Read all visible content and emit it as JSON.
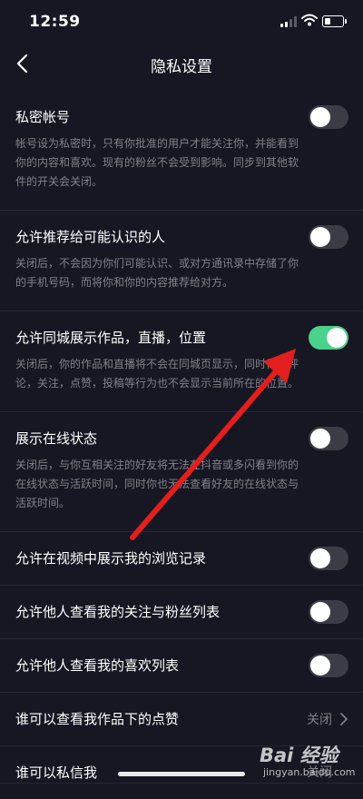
{
  "status_bar": {
    "time": "12:59"
  },
  "nav": {
    "title": "隐私设置"
  },
  "settings": [
    {
      "title": "私密帐号",
      "desc": "帐号设为私密时，只有你批准的用户才能关注你，并能看到你的内容和喜欢。现有的粉丝不会受到影响。同步到其他软件的开关会关闭。",
      "on": false
    },
    {
      "title": "允许推荐给可能认识的人",
      "desc": "关闭后，不会因为你们可能认识、或对方通讯录中存储了你的手机号码，而将你和你的内容推荐给对方。",
      "on": false
    },
    {
      "title": "允许同城展示作品，直播，位置",
      "desc": "关闭后，你的作品和直播将不会在同城页显示，同时你的评论，关注，点赞，投稿等行为也不会显示当前所在的位置。",
      "on": true
    },
    {
      "title": "展示在线状态",
      "desc": "关闭后，与你互相关注的好友将无法在抖音或多闪看到你的在线状态与活跃时间，同时你也无法查看好友的在线状态与活跃时间。",
      "on": false
    },
    {
      "title": "允许在视频中展示我的浏览记录",
      "on": false
    },
    {
      "title": "允许他人查看我的关注与粉丝列表",
      "on": false
    },
    {
      "title": "允许他人查看我的喜欢列表",
      "on": false
    }
  ],
  "link_rows": [
    {
      "title": "谁可以查看我作品下的点赞",
      "value": "关闭"
    },
    {
      "title": "谁可以私信我",
      "value": "关闭"
    }
  ],
  "watermark": {
    "text": "Bai 经验",
    "url": "jingyan.baidu.com"
  },
  "colors": {
    "background": "#161722",
    "toggle_on": "#4ad18b",
    "toggle_off": "#3b3c46",
    "annotation_arrow": "#e31e1e"
  }
}
